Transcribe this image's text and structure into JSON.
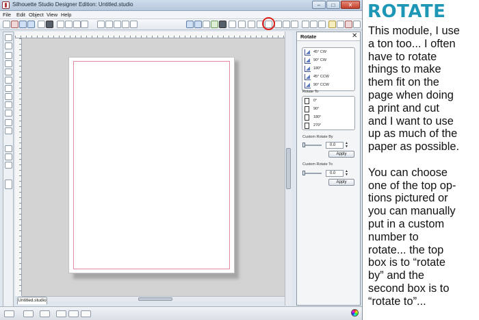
{
  "window": {
    "title": "Silhouette Studio Designer Edition: Untitled.studio",
    "minimize": "–",
    "maximize": "□",
    "close": "✕"
  },
  "menu": [
    "File",
    "Edit",
    "Object",
    "View",
    "Help"
  ],
  "highlight_color": "#e0201a",
  "document_tab": "Untitled.studio",
  "panel": {
    "title": "Rotate",
    "close": "✕",
    "rotate_by_options": [
      "45° CW",
      "90° CW",
      "180°",
      "45° CCW",
      "90° CCW"
    ],
    "rotate_to_label": "Rotate To",
    "rotate_to_options": [
      "0°",
      "90°",
      "180°",
      "270°"
    ],
    "custom_rotate_by": {
      "label": "Custom Rotate By",
      "value": "0.0",
      "apply": "Apply"
    },
    "custom_rotate_to": {
      "label": "Custom Rotate To",
      "value": "0.0",
      "apply": "Apply"
    }
  },
  "caption": {
    "heading": "ROTATE",
    "heading_color": "#1e96b6",
    "body": "This module, I use\na ton too... I often\nhave to rotate\nthings to make\nthem fit on the\npage when doing\na print and cut\nand I want to use\nup as much of the\npaper as possible.\n\nYou can choose\none of the top op-\ntions pictured or\nyou can manually\nput in a custom\nnumber to\nrotate...  the top\nbox is to “rotate\nby” and the\nsecond box is to\n“rotate to”..."
  }
}
